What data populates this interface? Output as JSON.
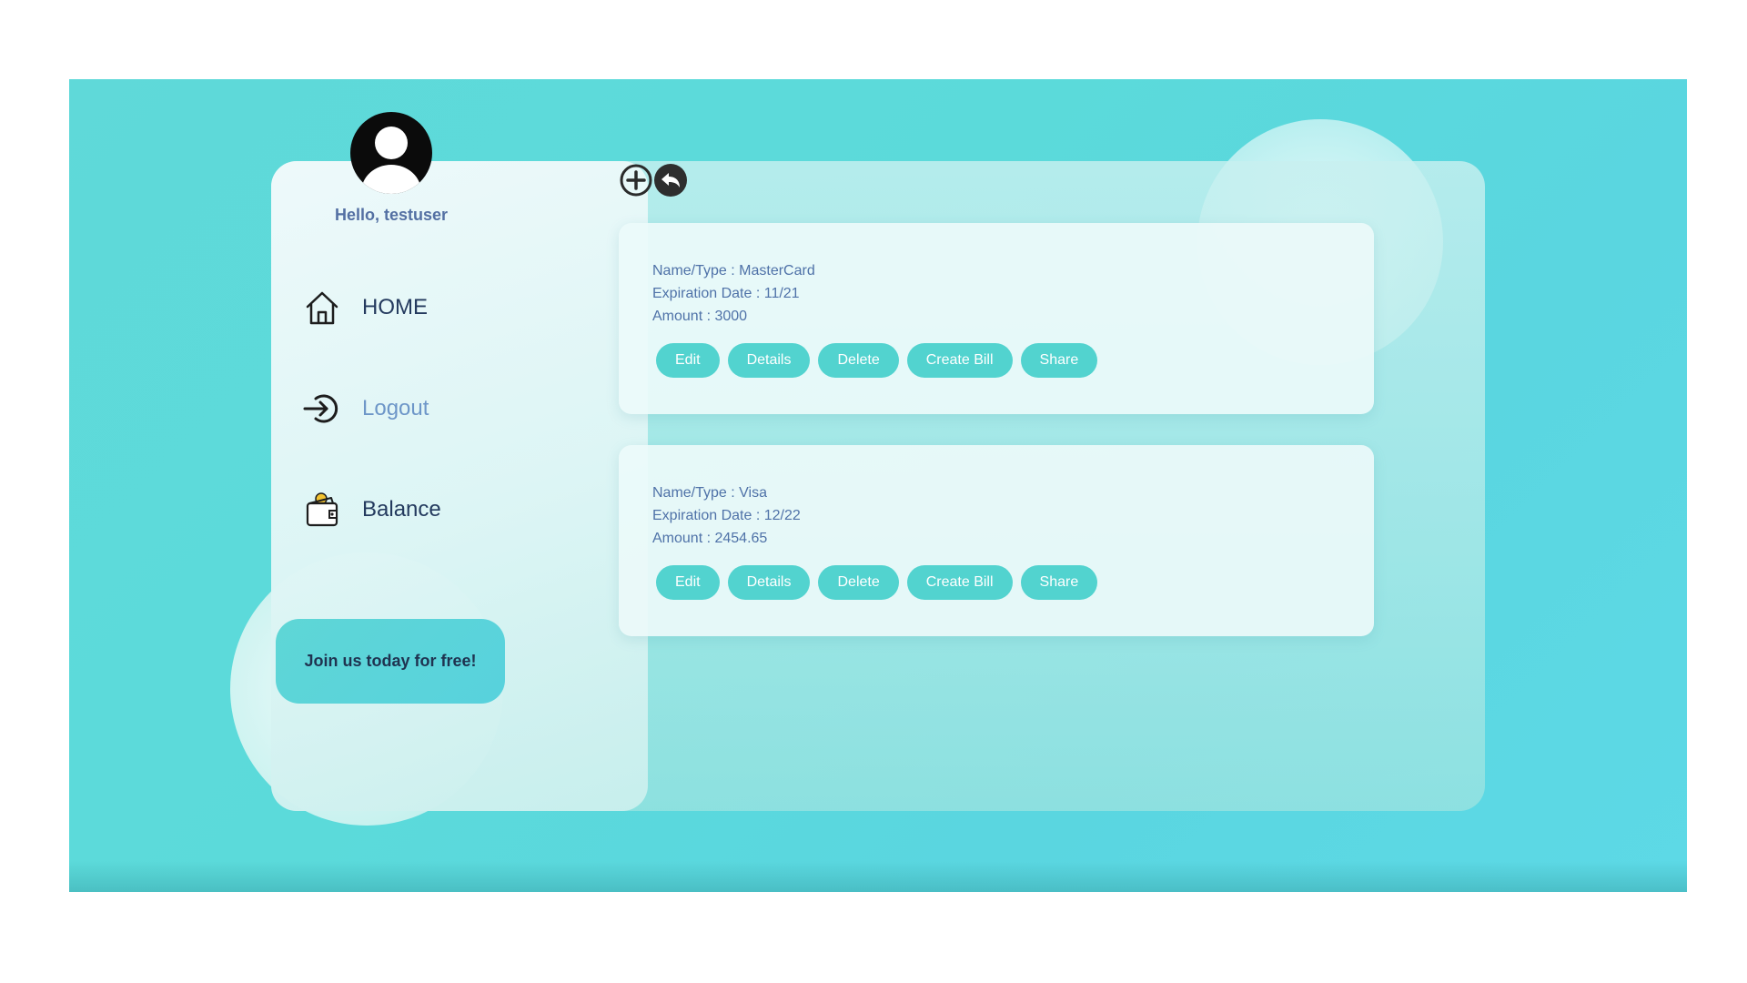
{
  "user": {
    "greeting": "Hello, testuser"
  },
  "nav": {
    "home": {
      "label": "HOME",
      "icon": "home-icon"
    },
    "logout": {
      "label": "Logout",
      "icon": "logout-icon"
    },
    "balance": {
      "label": "Balance",
      "icon": "wallet-icon"
    }
  },
  "sidebar": {
    "join_label": "Join us today for free!"
  },
  "toolbar": {
    "add_icon": "plus-circle-icon",
    "back_icon": "reply-icon"
  },
  "cards": [
    {
      "name_line": "Name/Type : MasterCard",
      "expiration_line": "Expiration Date : 11/21",
      "amount_line": "Amount : 3000",
      "actions": [
        "Edit",
        "Details",
        "Delete",
        "Create Bill",
        "Share"
      ]
    },
    {
      "name_line": "Name/Type : Visa",
      "expiration_line": "Expiration Date : 12/22",
      "amount_line": "Amount : 2454.65",
      "actions": [
        "Edit",
        "Details",
        "Delete",
        "Create Bill",
        "Share"
      ]
    }
  ],
  "colors": {
    "accent": "#52d3cf",
    "background": "#5bdada",
    "text_primary": "#243a5e",
    "text_link": "#6d96c8",
    "card_text": "#4f72a8"
  }
}
